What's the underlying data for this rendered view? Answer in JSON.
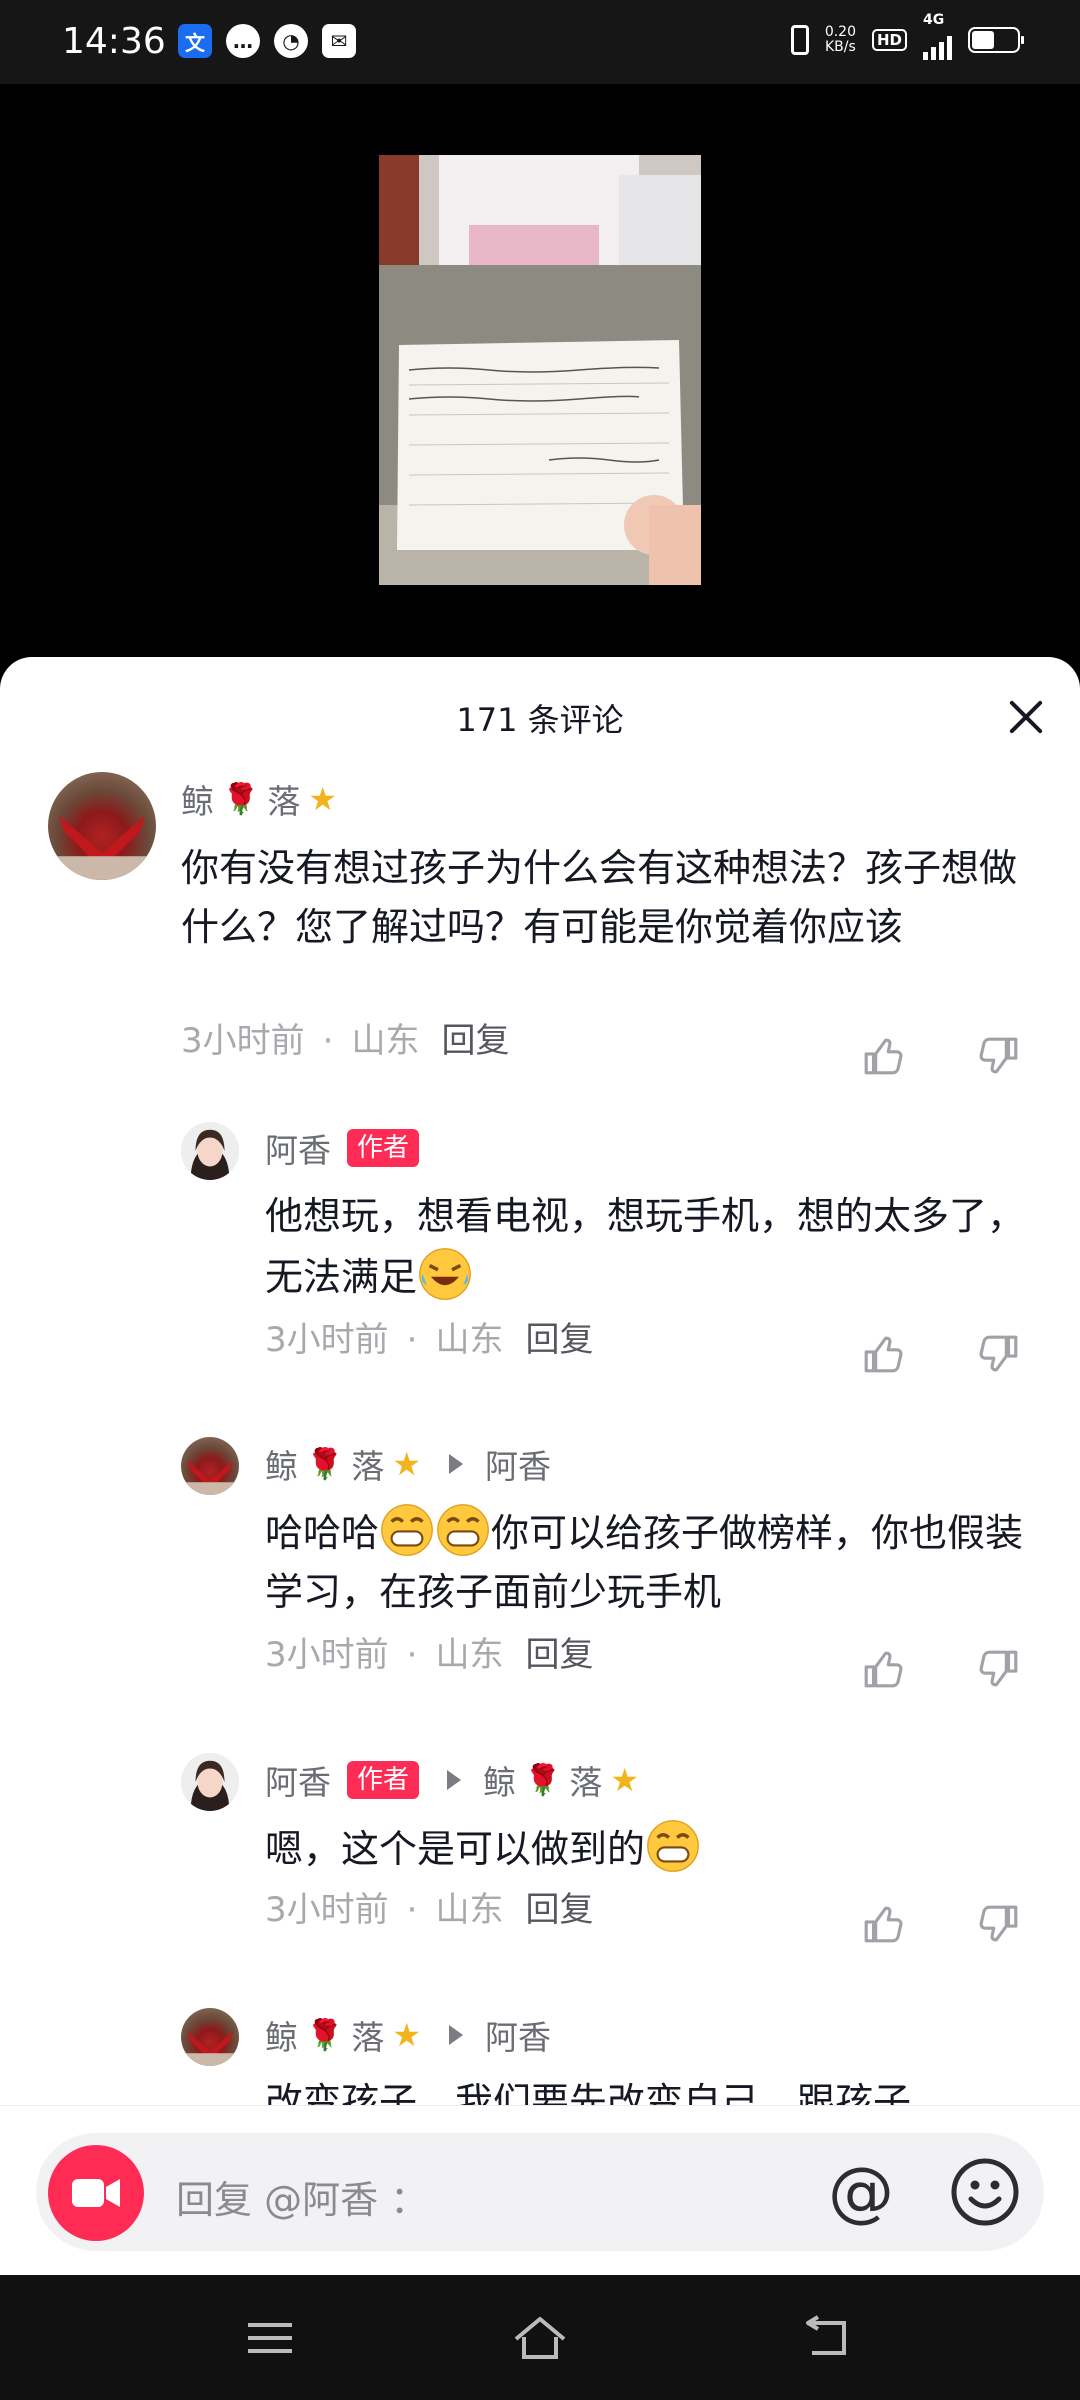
{
  "status_bar": {
    "time": "14:36",
    "net_speed_value": "0.20",
    "net_speed_unit": "KB/s",
    "hd": "HD",
    "network": "4G"
  },
  "comments_sheet": {
    "title": "171 条评论"
  },
  "comments": [
    {
      "nickname_part1": "鲸",
      "nickname_part2": "落",
      "text": "你有没有想过孩子为什么会有这种想法？孩子想做什么？您了解过吗？有可能是你觉着你应该",
      "time": "3小时前",
      "location": "山东",
      "reply_label": "回复"
    },
    {
      "nickname": "阿香",
      "badge": "作者",
      "text": "他想玩，想看电视，想玩手机，想的太多了，无法满足",
      "time": "3小时前",
      "location": "山东",
      "reply_label": "回复"
    },
    {
      "nickname_part1": "鲸",
      "nickname_part2": "落",
      "reply_to": "阿香",
      "text_a": "哈哈哈",
      "text_b": "你可以给孩子做榜样，你也假装学习，在孩子面前少玩手机",
      "time": "3小时前",
      "location": "山东",
      "reply_label": "回复"
    },
    {
      "nickname": "阿香",
      "badge": "作者",
      "reply_to_part1": "鲸",
      "reply_to_part2": "落",
      "text": "嗯，这个是可以做到的",
      "time": "3小时前",
      "location": "山东",
      "reply_label": "回复"
    },
    {
      "nickname_part1": "鲸",
      "nickname_part2": "落",
      "reply_to": "阿香",
      "text": "改变孩子，我们要先改变自己，跟孩子"
    }
  ],
  "input": {
    "placeholder": "回复 @阿香 ：",
    "at_symbol": "@"
  },
  "colors": {
    "accent": "#fe2c55",
    "text": "#161823",
    "meta": "#a8a9ad"
  },
  "icons": [
    "video-camera-icon",
    "at-icon",
    "smile-emoji-icon",
    "thumb-up-icon",
    "thumb-down-icon",
    "menu-icon",
    "home-icon",
    "back-icon",
    "close-icon"
  ]
}
